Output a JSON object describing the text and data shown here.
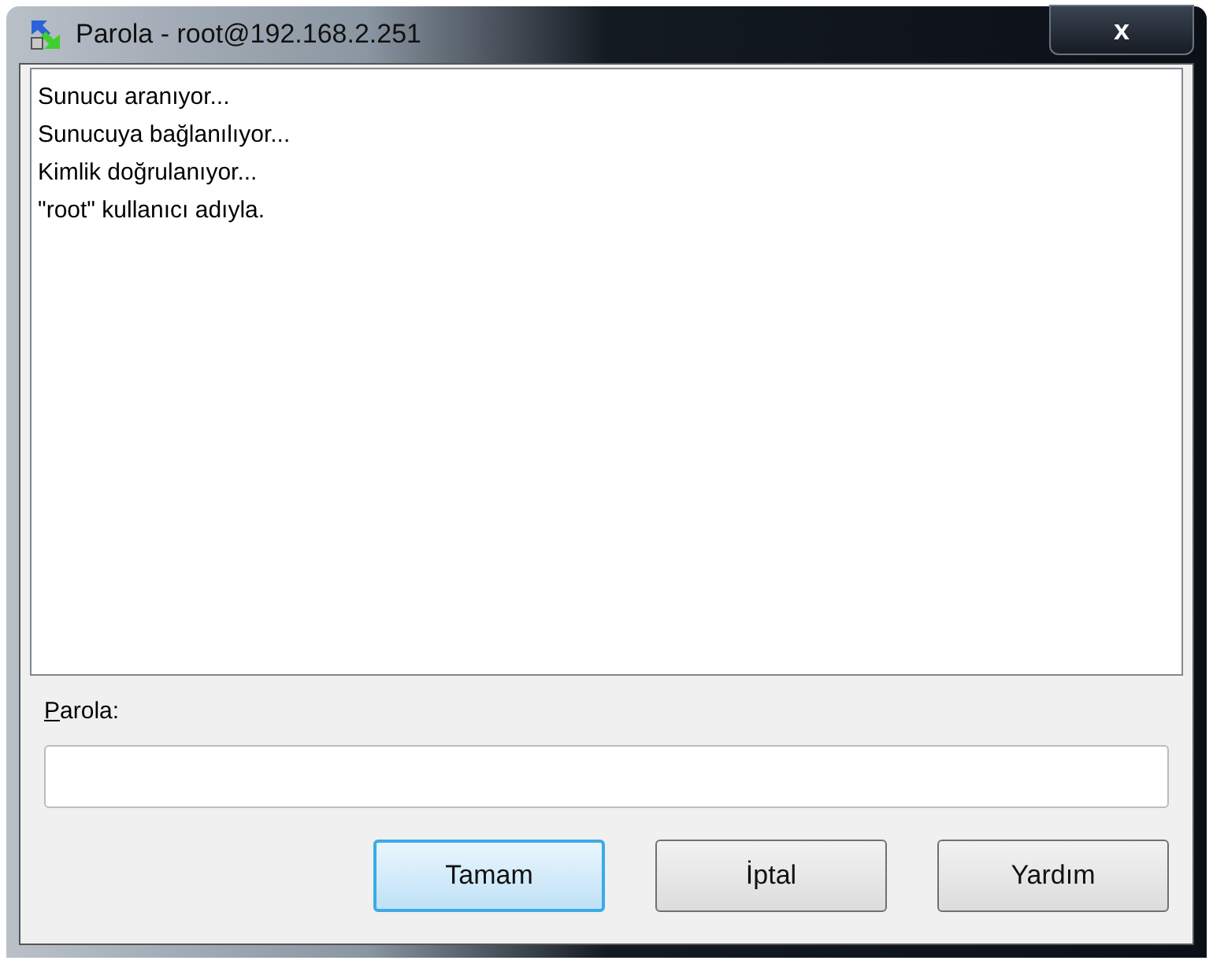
{
  "window": {
    "title": "Parola - root@192.168.2.251",
    "close": "x"
  },
  "log": [
    "Sunucu aranıyor...",
    "Sunucuya bağlanılıyor...",
    "Kimlik doğrulanıyor...",
    "\"root\" kullanıcı adıyla."
  ],
  "password": {
    "label": "Parola:",
    "mnemonic": true
  },
  "buttons": [
    {
      "label": "Tamam",
      "default": true
    },
    {
      "label": "İptal",
      "default": false
    },
    {
      "label": "Yardım",
      "default": false
    }
  ]
}
